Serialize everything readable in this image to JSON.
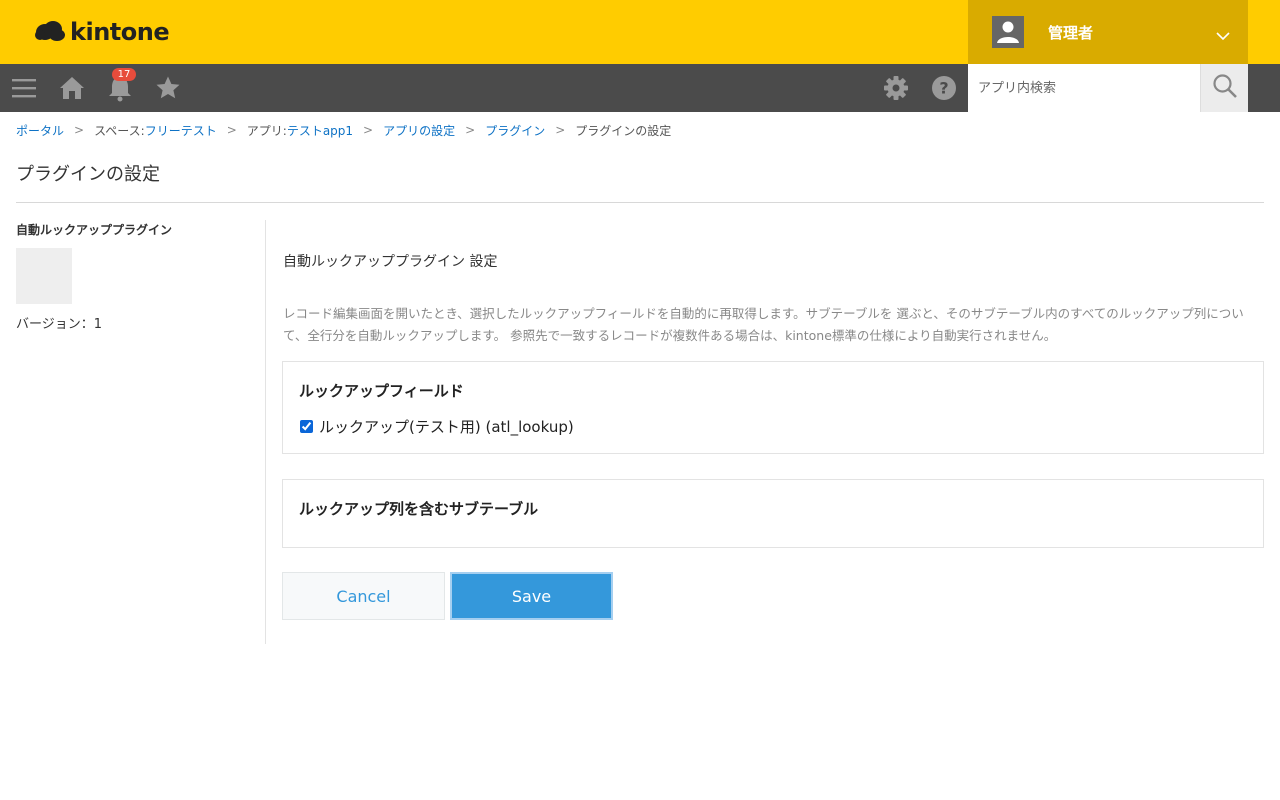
{
  "header": {
    "logo_text": "kintone",
    "user_name": "管理者"
  },
  "nav": {
    "notification_count": "17",
    "search_placeholder": "アプリ内検索"
  },
  "breadcrumb": {
    "portal": "ポータル",
    "space_prefix": "スペース: ",
    "space": "フリーテスト",
    "app_prefix": "アプリ: ",
    "app": "テストapp1",
    "app_settings": "アプリの設定",
    "plugins": "プラグイン",
    "current": "プラグインの設定",
    "separator": ">"
  },
  "page": {
    "title": "プラグインの設定"
  },
  "plugin": {
    "name": "自動ルックアッププラグイン",
    "version": "バージョン：1"
  },
  "settings": {
    "title": "自動ルックアッププラグイン 設定",
    "description": "レコード編集画面を開いたとき、選択したルックアップフィールドを自動的に再取得します。サブテーブルを 選ぶと、そのサブテーブル内のすべてのルックアップ列について、全行分を自動ルックアップします。 参照先で一致するレコードが複数件ある場合は、kintone標準の仕様により自動実行されません。",
    "lookup_section": {
      "title": "ルックアップフィールド",
      "fields": [
        {
          "label": "ルックアップ(テスト用) (atl_lookup)",
          "checked": true
        }
      ]
    },
    "subtable_section": {
      "title": "ルックアップ列を含むサブテーブル"
    }
  },
  "buttons": {
    "cancel": "Cancel",
    "save": "Save"
  },
  "colors": {
    "header_bg": "#ffcc00",
    "user_menu_bg": "#d9ab00",
    "navbar_bg": "#4b4b4b",
    "link": "#0e72c5",
    "save_button": "#3498db",
    "badge": "#e74c3c"
  }
}
